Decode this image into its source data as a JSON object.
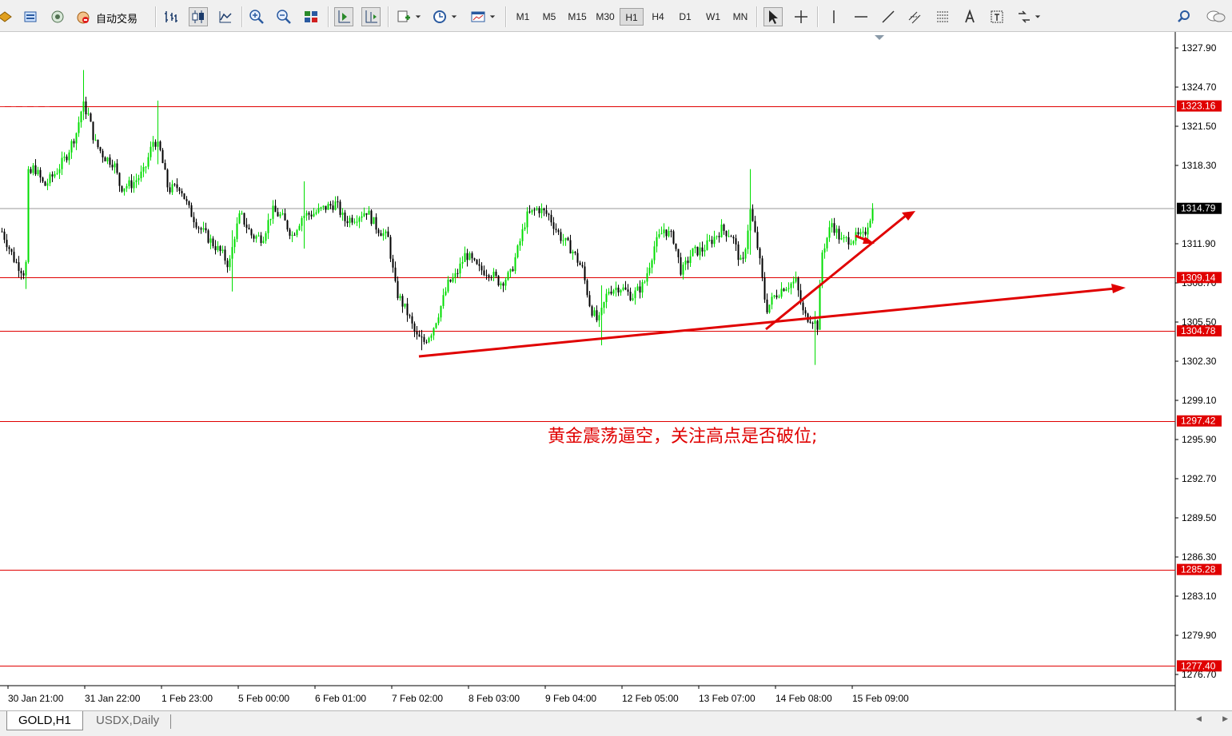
{
  "toolbar": {
    "auto_trade_label": "自动交易",
    "timeframes": [
      "M1",
      "M5",
      "M15",
      "M30",
      "H1",
      "H4",
      "D1",
      "W1",
      "MN"
    ],
    "active_timeframe": "H1"
  },
  "chart": {
    "symbol": "GOLD",
    "timeframe": "H1",
    "annotation": "黄金震荡逼空，关注高点是否破位;",
    "current_price": "1314.79",
    "price_axis_labels": [
      "1327.90",
      "1324.70",
      "1321.50",
      "1318.30",
      "1311.90",
      "1308.70",
      "1305.50",
      "1302.30",
      "1299.10",
      "1295.90",
      "1292.70",
      "1289.50",
      "1286.30",
      "1283.10",
      "1279.90",
      "1276.70"
    ],
    "horizontal_levels": [
      "1323.16",
      "1309.14",
      "1304.78",
      "1297.42",
      "1285.28",
      "1277.40"
    ],
    "time_axis_labels": [
      "30 Jan 21:00",
      "31 Jan 22:00",
      "1 Feb 23:00",
      "5 Feb 00:00",
      "6 Feb 01:00",
      "7 Feb 02:00",
      "8 Feb 03:00",
      "9 Feb 04:00",
      "12 Feb 05:00",
      "13 Feb 07:00",
      "14 Feb 08:00",
      "15 Feb 09:00"
    ],
    "colors": {
      "bull_candle": "#00dd00",
      "bear_candle": "#000000",
      "level_line": "#e00000",
      "level_label_bg": "#e00000",
      "current_label_bg": "#000000",
      "annotation": "#e00000",
      "trendline": "#e00000"
    }
  },
  "tabs": [
    {
      "label": "GOLD,H1",
      "active": true
    },
    {
      "label": "USDX,Daily",
      "active": false
    }
  ]
}
